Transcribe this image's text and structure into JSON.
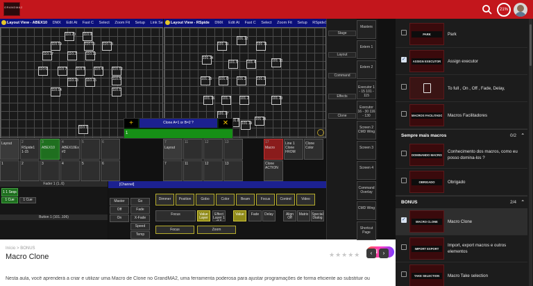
{
  "topbar": {
    "logo_text": "GRANDMA2",
    "progress": "21%"
  },
  "video": {
    "views": [
      {
        "title": "Layout View - ABEX10",
        "buttons": [
          "DMX",
          "Edit At",
          "Fast C",
          "Select",
          "Zoom Fit",
          "Setup",
          "Link Select"
        ]
      },
      {
        "title": "Layout View - RSpide",
        "buttons": [
          "DMX",
          "Edit At",
          "Fast C",
          "Select",
          "Zoom Fit",
          "Setup",
          "RSpide1 1-15"
        ]
      }
    ],
    "fixtures_left": [
      "110.20",
      "110.9",
      "110.19",
      "110.10",
      "110.18",
      "110.17",
      "110.2",
      "110.11",
      "110.7",
      "110.3",
      "110.4",
      "110.12",
      "110.6",
      "110.5",
      "110.13",
      "110.15",
      "110.14",
      "110.1"
    ],
    "fixtures_right": [
      "101.12",
      "101.13",
      "101.11",
      "101.14",
      "101.5",
      "101.4",
      "101.10",
      "101.15",
      "101.6",
      "101.3",
      "101.9",
      "101.16",
      "101.7",
      "101.2",
      "101.20",
      "101.17",
      "101.8",
      "101.18",
      "101.19"
    ],
    "dialog": {
      "title": "Clone A=1 or B=2 ?",
      "value": "1"
    },
    "exec_row1": [
      {
        "label": "Layout",
        "num": ""
      },
      {
        "label": "RSpide1 1-15",
        "num": "2"
      },
      {
        "label": "ABEX10",
        "num": "3"
      },
      {
        "label": "ABEX10Ex #2",
        "num": "4"
      },
      {
        "label": "",
        "num": "5"
      },
      {
        "label": "",
        "num": "6"
      },
      {
        "label": "Layout",
        "num": "7"
      },
      {
        "label": "",
        "num": "11"
      },
      {
        "label": "",
        "num": "12"
      },
      {
        "label": "",
        "num": "13"
      },
      {
        "label": "Macro",
        "num": "17"
      },
      {
        "label": "Line 1 Clone FROM",
        "num": ""
      },
      {
        "label": "Clone Color",
        "num": ""
      }
    ],
    "exec_row2": [
      "1",
      "2",
      "3",
      "4",
      "5",
      "6",
      "7",
      "11",
      "12",
      "13",
      "Clone ACTION"
    ],
    "right_panel": [
      "Stage",
      "Layout",
      "Command",
      "Effects",
      "Clone"
    ],
    "right_col": [
      "Masters",
      "Extern 1",
      "Extern 2",
      "Executor 1 - 15 101 - 115",
      "Executor 16 - 30 116 - 130",
      "Screen 2 CMD Wing",
      "Screen 3",
      "Screen 4",
      "Command Overlay",
      "CMD Wing",
      "Shortcut Page"
    ],
    "fader": {
      "title": "Fader 1 (1..6)",
      "items": [
        "1 1 Seqs",
        "1 Cue",
        "1 Cue"
      ],
      "button_title": "Button 1 (101..106)"
    },
    "channels_title": "[Channel]",
    "feature_tabs": [
      "Dimmer",
      "Position",
      "Gobo",
      "Color",
      "Beam",
      "Focus",
      "Control",
      "Video"
    ],
    "attribute_cells": [
      "Focus",
      "Value Layer",
      "Effect Layer 1 of 5",
      "Value",
      "Fade",
      "Delay",
      "Align Off",
      "Matrix",
      "Special Dialog"
    ],
    "bottom_cells": [
      "Focus",
      "Zoom"
    ],
    "master_cells": [
      "Master",
      "Off",
      "On",
      "Go",
      "Fade",
      "X-Fade",
      "Speed",
      "Temp"
    ],
    "nic_logo": "NIC"
  },
  "page": {
    "breadcrumb_home": "Início",
    "breadcrumb_sep": ">",
    "breadcrumb_section": "BONUS",
    "title": "Macro Clone",
    "rating_stars": "★★★★★",
    "prev": "‹",
    "next": "›",
    "description": "Nesta aula, você aprenderá a criar e utilizar uma Macro de Clone no GrandMA2, uma ferramenta poderosa para ajustar programações de forma eficiente ao substituir ou"
  },
  "sidebar": {
    "lessons_top": [
      {
        "label": "Park",
        "thumb": "PARK",
        "checked": false
      },
      {
        "label": "Assign executor",
        "thumb": "ASSIGN EXECUTOR",
        "checked": true
      },
      {
        "label": "To full , On , Off , Fade, Delay,",
        "thumb": "",
        "checked": false,
        "doc": true
      },
      {
        "label": "Macros Facilitadores",
        "thumb": "MACROS FACILITADORES",
        "checked": false
      }
    ],
    "section2": {
      "title": "Sempre mais macros",
      "count": "0/2",
      "caret": "⌃"
    },
    "lessons_mid": [
      {
        "label": "Conhecimento dos macros, como eu posso domina-los ?",
        "thumb": "DOMINANDO MACROS",
        "checked": false
      },
      {
        "label": "Obrigado",
        "thumb": "OBRIGADO",
        "checked": false
      }
    ],
    "section3": {
      "title": "BONUS",
      "count": "2/4",
      "caret": "⌃"
    },
    "lessons_bonus": [
      {
        "label": "Macro Clone",
        "thumb": "MACRO CLONE",
        "checked": true
      },
      {
        "label": "Import, export macros e outros elementos",
        "thumb": "IMPORT EXPORT",
        "checked": false
      },
      {
        "label": "Macro Take selection",
        "thumb": "TAKE SELECTION",
        "checked": false
      }
    ]
  }
}
